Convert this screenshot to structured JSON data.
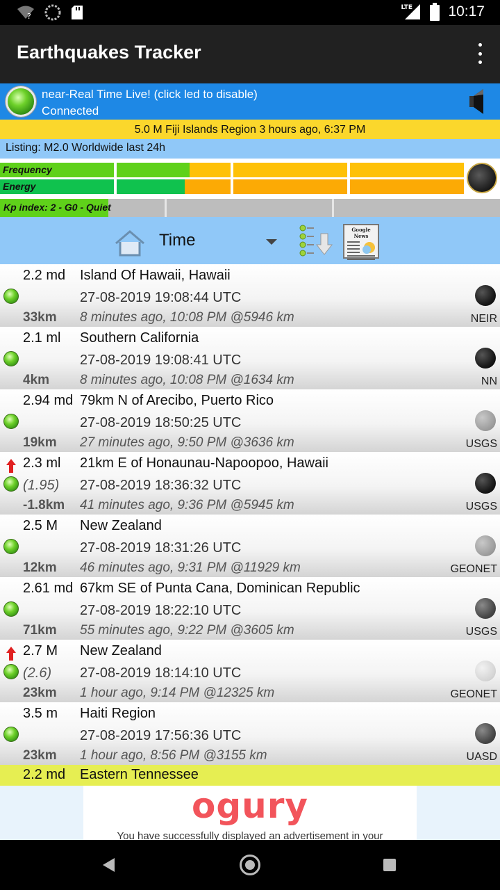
{
  "status_bar": {
    "time": "10:17",
    "network": "LTE"
  },
  "app": {
    "title": "Earthquakes Tracker"
  },
  "live": {
    "line1": "near-Real Time Live! (click led to disable)",
    "line2": "Connected"
  },
  "alert": "5.0 M Fiji Islands Region 3 hours ago, 6:37 PM",
  "listing": "Listing: M2.0 Worldwide last 24h",
  "meters": {
    "frequency_label": "Frequency",
    "energy_label": "Energy",
    "kp_label": "Kp index: 2 - G0 - Quiet"
  },
  "toolbar": {
    "sort_label": "Time",
    "news_header": "Google News"
  },
  "quakes": [
    {
      "mag": "2.2 md",
      "place": "Island Of Hawaii, Hawaii",
      "utc": "27-08-2019 19:08:44 UTC",
      "depth": "33km",
      "ago": "8 minutes ago, 10:08 PM @5946 km",
      "source": "NEIR",
      "prev": "",
      "moon": "dark"
    },
    {
      "mag": "2.1 ml",
      "place": "Southern California",
      "utc": "27-08-2019 19:08:41 UTC",
      "depth": "4km",
      "ago": "8 minutes ago, 10:08 PM @1634 km",
      "source": "NN",
      "prev": "",
      "moon": "dark"
    },
    {
      "mag": "2.94 md",
      "place": "79km N of Arecibo, Puerto Rico",
      "utc": "27-08-2019 18:50:25 UTC",
      "depth": "19km",
      "ago": "27 minutes ago, 9:50 PM @3636 km",
      "source": "USGS",
      "prev": "",
      "moon": "gray"
    },
    {
      "mag": "2.3 ml",
      "place": "21km E of Honaunau-Napoopoo, Hawaii",
      "utc": "27-08-2019 18:36:32 UTC",
      "depth": "-1.8km",
      "ago": "41 minutes ago, 9:36 PM @5945 km",
      "source": "USGS",
      "prev": "(1.95)",
      "moon": "dark"
    },
    {
      "mag": "2.5 M",
      "place": "New Zealand",
      "utc": "27-08-2019 18:31:26 UTC",
      "depth": "12km",
      "ago": "46 minutes ago, 9:31 PM @11929 km",
      "source": "GEONET",
      "prev": "",
      "moon": "gray"
    },
    {
      "mag": "2.61 md",
      "place": "67km SE of Punta Cana, Dominican Republic",
      "utc": "27-08-2019 18:22:10 UTC",
      "depth": "71km",
      "ago": "55 minutes ago, 9:22 PM @3605 km",
      "source": "USGS",
      "prev": "",
      "moon": "mid"
    },
    {
      "mag": "2.7 M",
      "place": "New Zealand",
      "utc": "27-08-2019 18:14:10 UTC",
      "depth": "23km",
      "ago": "1 hour ago, 9:14 PM @12325 km",
      "source": "GEONET",
      "prev": "(2.6)",
      "moon": "light"
    },
    {
      "mag": "3.5 m",
      "place": "Haiti Region",
      "utc": "27-08-2019 17:56:36 UTC",
      "depth": "23km",
      "ago": "1 hour ago, 8:56 PM @3155 km",
      "source": "UASD",
      "prev": "",
      "moon": "mid"
    }
  ],
  "partial_row": {
    "mag": "2.2 md",
    "place": "Eastern Tennessee"
  },
  "ad": {
    "logo": "ogury",
    "message": "You have successfully displayed an advertisement in your"
  }
}
